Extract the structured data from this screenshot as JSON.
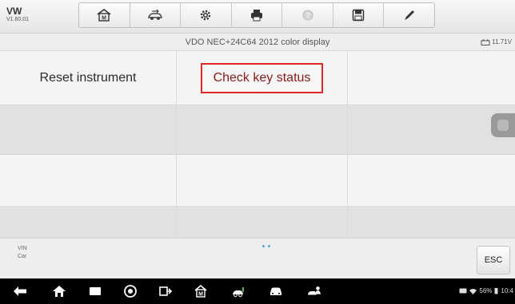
{
  "app": {
    "brand": "VW",
    "version": "V1.60.01"
  },
  "toolbar": {
    "buttons": [
      {
        "icon": "home-icon"
      },
      {
        "icon": "vehicle-swap-icon"
      },
      {
        "icon": "settings-gear-icon"
      },
      {
        "icon": "print-icon"
      },
      {
        "icon": "help-icon"
      },
      {
        "icon": "save-icon"
      },
      {
        "icon": "edit-pen-icon"
      }
    ]
  },
  "titlebar": {
    "title": "VDO NEC+24C64 2012 color display",
    "voltage": "11.71V"
  },
  "grid": {
    "items": [
      "Reset instrument",
      "Check key status"
    ],
    "highlighted_index": 1
  },
  "infobar": {
    "vin_label": "VIN",
    "car_label": "Car",
    "esc_label": "ESC"
  },
  "statusbar": {
    "battery": "56%",
    "time": "10:4"
  },
  "colors": {
    "highlight_border": "#e0262b",
    "highlight_text": "#8b1a1a"
  }
}
